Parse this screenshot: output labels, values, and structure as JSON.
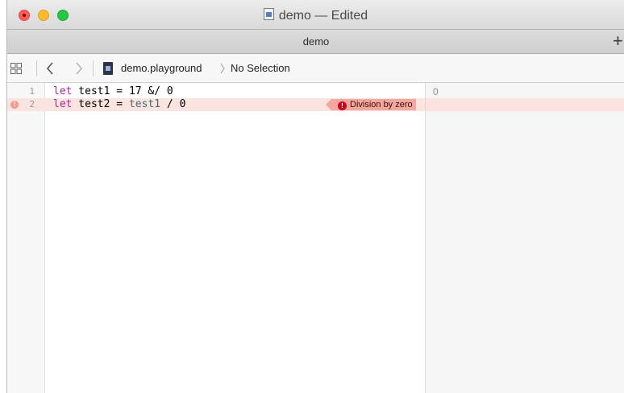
{
  "window": {
    "title": "demo — Edited"
  },
  "tabbar": {
    "tab_label": "demo",
    "add_label": "+"
  },
  "jumpbar": {
    "back_label": "<",
    "forward_label": ">",
    "file": "demo.playground",
    "chevron": ">",
    "selection": "No Selection"
  },
  "editor": {
    "lines": [
      {
        "number": "1",
        "tokens": [
          "let",
          " test1 = ",
          "17",
          " &/ ",
          "0"
        ]
      },
      {
        "number": "2",
        "has_error": true,
        "tokens": [
          "let",
          " test2 = ",
          "test1",
          " / ",
          "0"
        ],
        "error_icon": "!",
        "error_message": "Division by zero"
      }
    ]
  },
  "results": {
    "rows": [
      "0",
      ""
    ]
  },
  "colors": {
    "keyword": "#b0219c",
    "identifier": "#3e6d74",
    "number": "#272ad8",
    "error_line": "#fbe3e0",
    "error_badge": "#f3a79e"
  },
  "icons": {
    "close": "close-button-icon",
    "minimize": "minimize-button-icon",
    "zoom": "zoom-button-icon",
    "document": "document-icon",
    "grid": "related-items-grid-icon",
    "playground": "playground-file-icon",
    "error": "error-icon"
  }
}
